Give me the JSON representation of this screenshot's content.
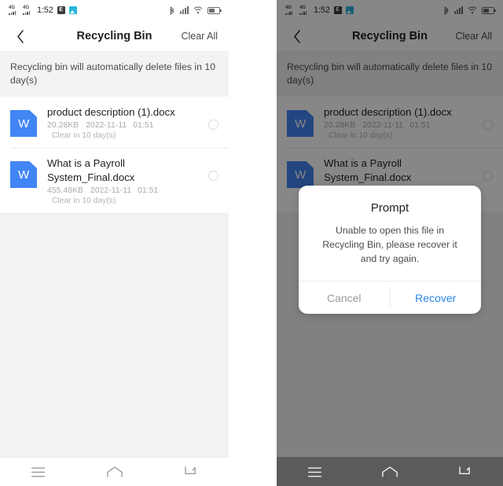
{
  "status_bar": {
    "network_label": "4G",
    "network_label_2": "4G",
    "time": "1:52",
    "app_badge_letter": "E",
    "icons": [
      "signal-4g-icon",
      "signal-4g-icon",
      "clock-text",
      "app-badge-icon",
      "camera-badge-icon",
      "bluetooth-icon",
      "signal-bars-icon",
      "wifi-icon",
      "battery-icon"
    ]
  },
  "app_bar": {
    "back_label": "Back",
    "title": "Recycling Bin",
    "action_label": "Clear All"
  },
  "banner": {
    "text": "Recycling bin will automatically delete files in 10 day(s)"
  },
  "files": [
    {
      "name": "product description (1).docx",
      "size": "20.28KB",
      "date": "2022-11-11",
      "time": "01:51",
      "clear_text": "Clear in 10 day(s)",
      "icon_letter": "W",
      "selected": false
    },
    {
      "name": "What is a Payroll System_Final.docx",
      "size": "455.48KB",
      "date": "2022-11-11",
      "time": "01:51",
      "clear_text": "Clear in 10 day(s)",
      "icon_letter": "W",
      "selected": false
    }
  ],
  "nav_bar": {
    "recents_label": "Recents",
    "home_label": "Home",
    "back_label": "Back"
  },
  "dialog": {
    "title": "Prompt",
    "message": "Unable to open this file in Recycling Bin, please recover it and try again.",
    "cancel_label": "Cancel",
    "confirm_label": "Recover"
  },
  "colors": {
    "accent": "#2a86e8",
    "file_icon": "#4285f4",
    "banner_bg": "#f2f3f5",
    "overlay": "rgba(0,0,0,0.47)"
  }
}
